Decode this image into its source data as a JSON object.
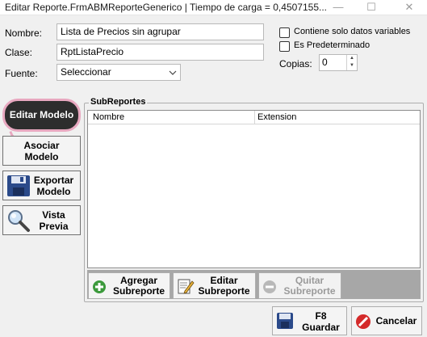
{
  "window": {
    "title": "Editar Reporte.FrmABMReporteGenerico | Tiempo de carga = 0,4507155...",
    "minimize_glyph": "—",
    "maximize_glyph": "☐",
    "close_glyph": "✕"
  },
  "form": {
    "nombre_label": "Nombre:",
    "nombre_value": "Lista de Precios sin agrupar",
    "clase_label": "Clase:",
    "clase_value": "RptListaPrecio",
    "fuente_label": "Fuente:",
    "fuente_value": "Seleccionar",
    "chk_solo_datos_label": "Contiene solo datos variables",
    "chk_solo_datos_checked": false,
    "chk_predeterminado_label": "Es Predeterminado",
    "chk_predeterminado_checked": false,
    "copias_label": "Copias:",
    "copias_value": "0"
  },
  "left_buttons": {
    "editar_modelo": "Editar Modelo",
    "asociar_line1": "Asociar",
    "asociar_line2": "Modelo",
    "exportar_line1": "Exportar",
    "exportar_line2": "Modelo",
    "vista_line1": "Vista",
    "vista_line2": "Previa"
  },
  "subreportes": {
    "group_title": "SubReportes",
    "columns": [
      "Nombre",
      "Extension"
    ],
    "rows": [],
    "agregar_line1": "Agregar",
    "agregar_line2": "Subreporte",
    "editar_line1": "Editar",
    "editar_line2": "Subreporte",
    "quitar_line1": "Quitar",
    "quitar_line2": "Subreporte"
  },
  "bottom": {
    "guardar_line1": "F8",
    "guardar_line2": "Guardar",
    "cancelar": "Cancelar"
  },
  "colors": {
    "highlight_ring": "#e8a8c0",
    "editar_modelo_bg": "#2d2d2d",
    "footer_bar": "#a7a7a7"
  }
}
